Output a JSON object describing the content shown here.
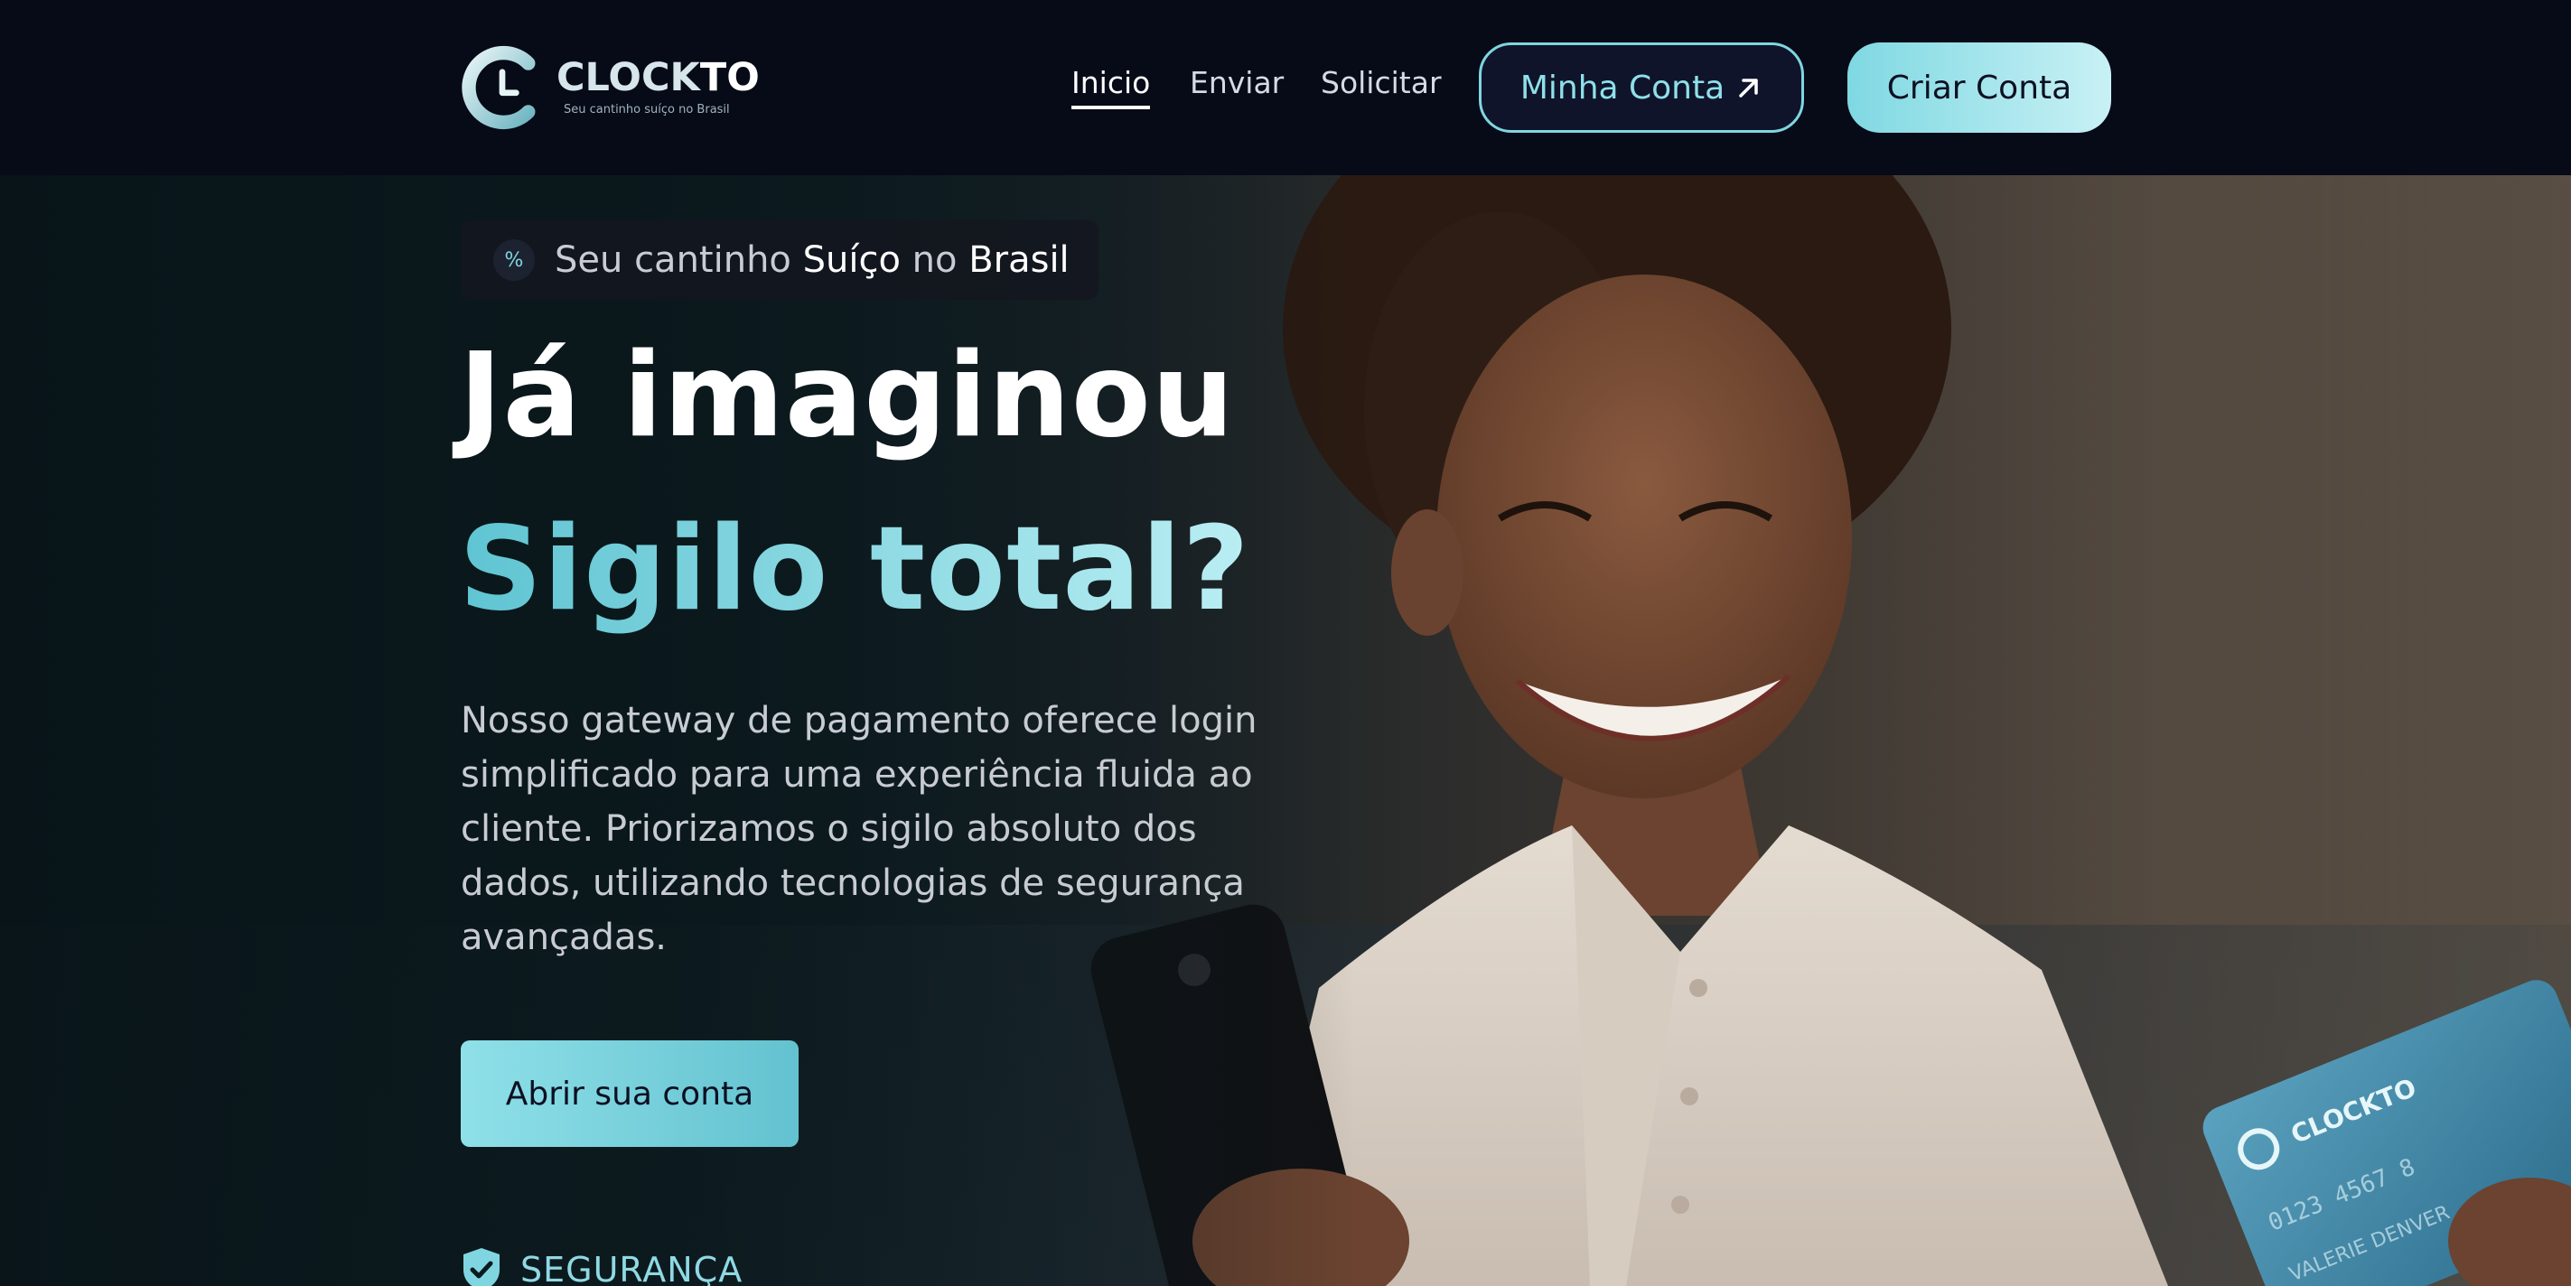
{
  "nav": {
    "logo": {
      "word_a": "CLOCK",
      "word_b": "TO",
      "tagline": "Seu cantinho suíço no Brasil"
    },
    "links": [
      {
        "label": "Inicio",
        "active": true
      },
      {
        "label": "Enviar",
        "active": false
      },
      {
        "label": "Solicitar",
        "active": false
      }
    ],
    "account_button": "Minha Conta",
    "create_button": "Criar Conta"
  },
  "hero": {
    "badge": {
      "pre": "Seu cantinho ",
      "bold1": "Suíço",
      "mid": " no ",
      "bold2": "Brasil"
    },
    "title_line1": "Já imaginou",
    "title_line2": "Sigilo total?",
    "description": "Nosso gateway de pagamento oferece login simplificado para uma experiência fluida ao cliente. Priorizamos o sigilo absoluto dos dados, utilizando tecnologias de segurança avançadas.",
    "cta": "Abrir sua conta",
    "security_label": "SEGURANÇA",
    "card": {
      "brand": "CLOCKTO",
      "number": "0123 4567 8",
      "holder": "VALERIE DENVER"
    }
  },
  "colors": {
    "accent": "#7fd6e0",
    "background": "#070a17"
  }
}
